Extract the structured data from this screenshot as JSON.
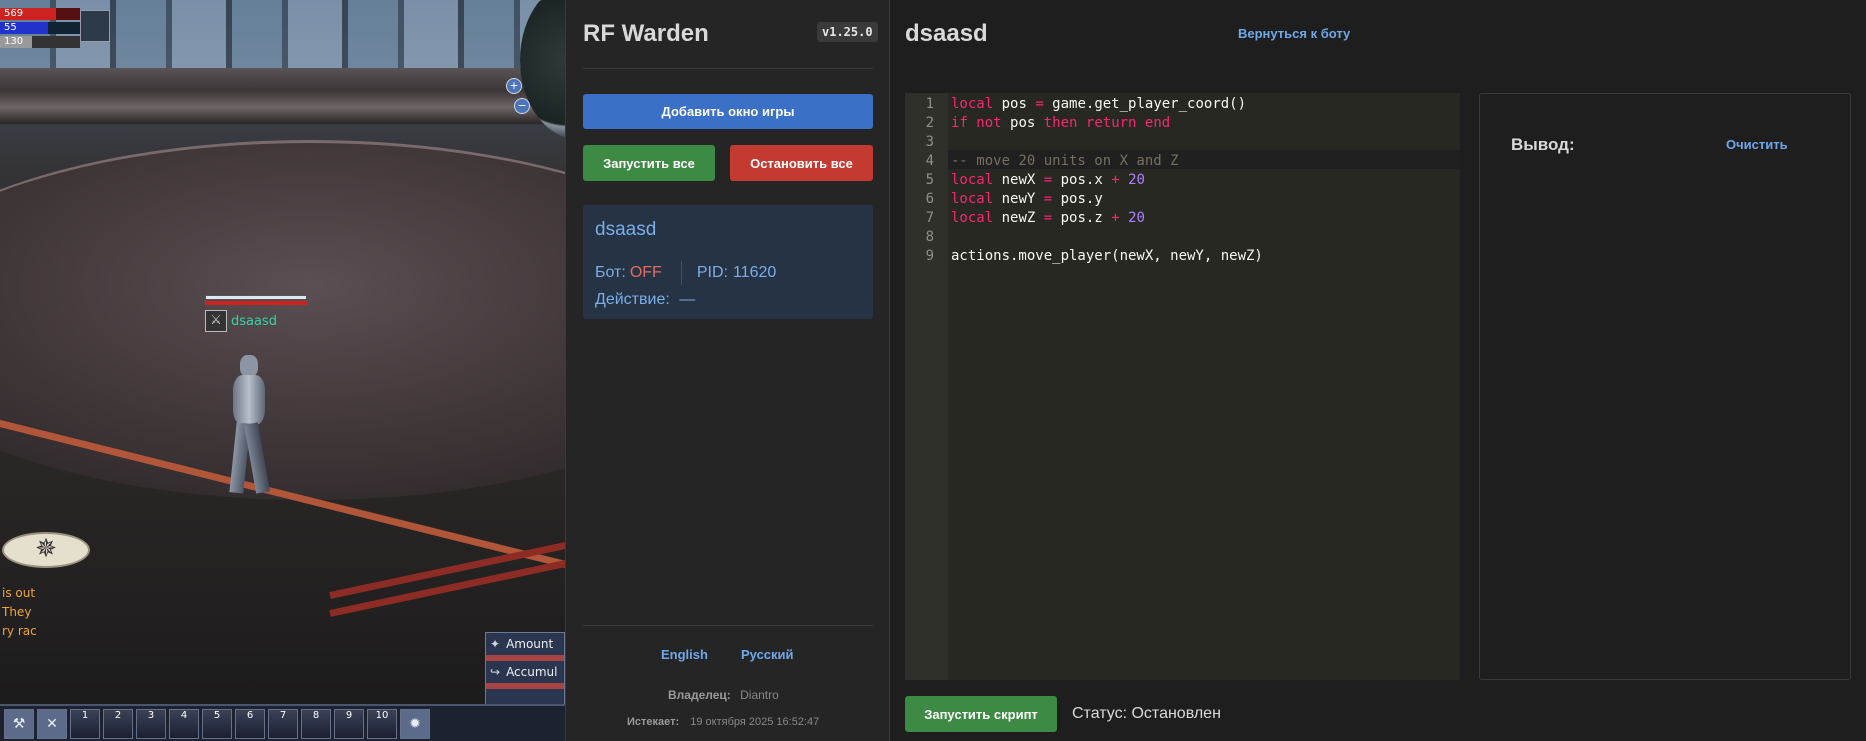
{
  "game": {
    "hud": {
      "hp": "569",
      "fp": "55",
      "sp": "130"
    },
    "player_name": "dsaasd",
    "chat_lines": [
      "is out",
      "They",
      "ry rac"
    ],
    "panel_rows": [
      "Amount",
      "Accumul"
    ],
    "hotbar": [
      "1",
      "2",
      "3",
      "4",
      "5",
      "6",
      "7",
      "8",
      "9",
      "10"
    ]
  },
  "sidebar": {
    "title": "RF Warden",
    "version": "v1.25.0",
    "add_window_label": "Добавить окно игры",
    "start_all_label": "Запустить все",
    "stop_all_label": "Остановить все",
    "bot_card": {
      "name": "dsaasd",
      "bot_label": "Бот:",
      "bot_state": "OFF",
      "pid_label": "PID:",
      "pid": "11620",
      "action_label": "Действие:",
      "action_value": "—"
    },
    "languages": [
      "English",
      "Русский"
    ],
    "owner_label": "Владелец:",
    "owner": "Diantro",
    "expires_label": "Истекает:",
    "expires": "19 октября 2025 16:52:47"
  },
  "main": {
    "bot_title": "dsaasd",
    "back_link": "Вернуться к боту",
    "code_lines": [
      "local pos = game.get_player_coord()",
      "if not pos then return end",
      "",
      "-- move 20 units on X and Z",
      "local newX = pos.x + 20",
      "local newY = pos.y",
      "local newZ = pos.z + 20",
      "",
      "actions.move_player(newX, newY, newZ)"
    ],
    "output_label": "Вывод:",
    "clear_label": "Очистить",
    "run_label": "Запустить скрипт",
    "status": "Статус: Остановлен"
  },
  "colors": {
    "accent_blue": "#3a70c6",
    "success_green": "#3c8a43",
    "danger_red": "#c43a30",
    "link_blue": "#6fa8ea"
  }
}
